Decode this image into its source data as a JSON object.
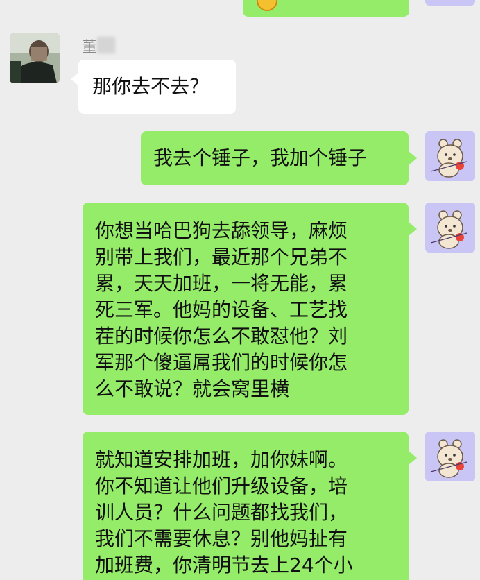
{
  "messages": [
    {
      "sender": "other",
      "name": "董",
      "text": "那你去不去？"
    },
    {
      "sender": "self",
      "text": "我去个锤子，我加个锤子"
    },
    {
      "sender": "self",
      "text": "你想当哈巴狗去舔领导，麻烦\n别带上我们，最近那个兄弟不\n累，天天加班，一将无能，累\n死三军。他妈的设备、工艺找\n茬的时候你怎么不敢怼他？刘\n军那个傻逼屌我们的时候你怎\n么不敢说？就会窝里横"
    },
    {
      "sender": "self",
      "text": "就知道安排加班，加你妹啊。\n你不知道让他们升级设备，培\n训人员？什么问题都找我们，\n我们不需要休息？别他妈扯有\n加班费，你清明节去上24个小"
    }
  ],
  "avatars": {
    "self": "bear-avatar-icon",
    "other": "person-photo-avatar-blurred"
  },
  "colors": {
    "background": "#ededed",
    "self_bubble": "#95ec69",
    "other_bubble": "#ffffff",
    "self_avatar_bg": "#c9c6f5"
  }
}
